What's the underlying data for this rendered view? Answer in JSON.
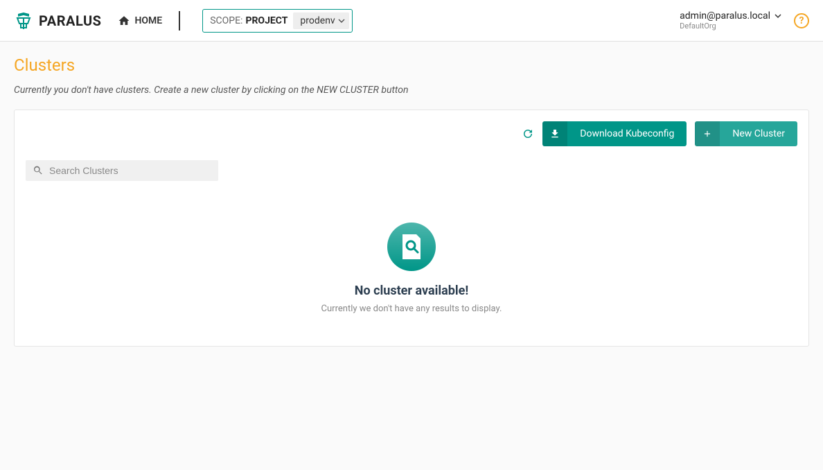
{
  "header": {
    "brand": "PARALUS",
    "home_label": "HOME",
    "scope_label": "SCOPE:",
    "scope_kind": "PROJECT",
    "scope_value": "prodenv"
  },
  "user": {
    "email": "admin@paralus.local",
    "org": "DefaultOrg"
  },
  "page": {
    "title": "Clusters",
    "subtitle": "Currently you don't have clusters. Create a new cluster by clicking on the NEW CLUSTER button"
  },
  "actions": {
    "download_label": "Download Kubeconfig",
    "new_label": "New Cluster"
  },
  "search": {
    "placeholder": "Search Clusters"
  },
  "empty": {
    "title": "No cluster available!",
    "desc": "Currently we don't have any results to display."
  },
  "colors": {
    "accent_teal": "#009688",
    "accent_orange": "#f5a623"
  }
}
